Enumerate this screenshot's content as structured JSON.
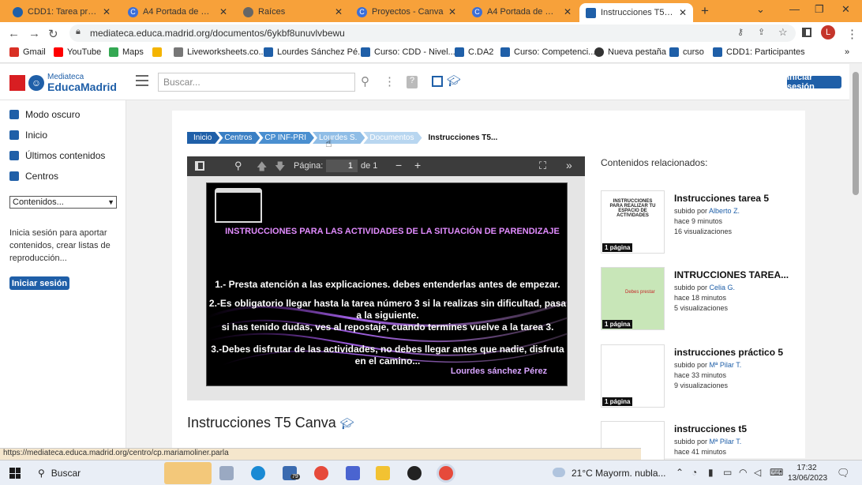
{
  "browser": {
    "tabs": [
      {
        "label": "CDD1: Tarea práctica",
        "color": "#1f5fa8"
      },
      {
        "label": "A4 Portada de Propue",
        "color": "#3b6fd8"
      },
      {
        "label": "Raíces",
        "color": "#555555"
      },
      {
        "label": "Proyectos - Canva",
        "color": "#3b6fd8"
      },
      {
        "label": "A4 Portada de Propue",
        "color": "#3b6fd8"
      },
      {
        "label": "Instrucciones T5 Canv",
        "color": "#1f5fa8"
      }
    ],
    "new_tab": "+",
    "url": "mediateca.educa.madrid.org/documentos/6ykbf8unuvlvbewu",
    "profile_initial": "L",
    "bookmarks": [
      {
        "label": "Gmail",
        "color": "#d93025"
      },
      {
        "label": "YouTube",
        "color": "#ff0000"
      },
      {
        "label": "Maps",
        "color": "#34a853"
      },
      {
        "label": "",
        "color": "#f4b400"
      },
      {
        "label": "Liveworksheets.co...",
        "color": "#777777"
      },
      {
        "label": "Lourdes Sánchez Pé...",
        "color": "#1f5fa8"
      },
      {
        "label": "Curso: CDD - Nivel...",
        "color": "#1f5fa8"
      },
      {
        "label": "C.DA2",
        "color": "#1f5fa8"
      },
      {
        "label": "Curso: Competenci...",
        "color": "#1f5fa8"
      },
      {
        "label": "Nueva pestaña",
        "color": "#333333"
      },
      {
        "label": "curso",
        "color": "#1f5fa8"
      },
      {
        "label": "CDD1: Participantes",
        "color": "#1f5fa8"
      }
    ]
  },
  "header": {
    "logo_small": "Mediateca",
    "logo_big": "EducaMadrid",
    "search_placeholder": "Buscar...",
    "login_label": "Iniciar sesión"
  },
  "sidebar": {
    "items": [
      "Modo oscuro",
      "Inicio",
      "Últimos contenidos",
      "Centros"
    ],
    "select_value": "Contenidos...",
    "info": "Inicia sesión para aportar contenidos, crear listas de reproducción...",
    "login_label": "Iniciar sesión"
  },
  "breadcrumb": {
    "items": [
      {
        "label": "Inicio",
        "color": "#1f5fa8"
      },
      {
        "label": "Centros",
        "color": "#3a7fc4"
      },
      {
        "label": "CP INF-PRI",
        "color": "#4a8fd0"
      },
      {
        "label": "Lourdes S.",
        "color": "#8fbde6"
      },
      {
        "label": "Documentos",
        "color": "#b8d6f0"
      }
    ],
    "current": "Instrucciones T5..."
  },
  "pdf": {
    "page_label": "Página:",
    "page_value": "1",
    "page_total": "de 1",
    "slide_title": "INSTRUCCIONES PARA LAS ACTIVIDADES DE LA SITUACIÓN DE PARENDIZAJE",
    "slide_lines": [
      "1.- Presta  atención a las explicaciones. debes entenderlas antes de empezar.",
      "2.-Es obligatorio llegar hasta la tarea número 3 si la realizas sin dificultad, pasa a la siguiente.",
      "si has tenido dudas, ves al repostaje, cuando termines vuelve a la tarea 3.",
      "3.-Debes disfrutar de las actividades, no debes llegar antes que nadie, disfruta en el camino...",
      "Lourdes  sánchez Pérez"
    ]
  },
  "document": {
    "title": "Instrucciones T5 Canva"
  },
  "related": {
    "heading": "Contenidos relacionados:",
    "items": [
      {
        "title": "Instrucciones tarea 5",
        "uploader_prefix": "subido por",
        "user": "Alberto Z.",
        "time": "hace 9 minutos",
        "views": "16 visualizaciones",
        "pages": "1 página",
        "thumb_text": "INSTRUCCIONES PARA REALIZAR TU ESPACIO DE ACTIVIDADES"
      },
      {
        "title": "INTRUCCIONES TAREA...",
        "uploader_prefix": "subido por",
        "user": "Celia G.",
        "time": "hace 18 minutos",
        "views": "5 visualizaciones",
        "pages": "1 página",
        "thumb_text": "Debes prestar"
      },
      {
        "title": "instrucciones práctico 5",
        "uploader_prefix": "subido por",
        "user": "Mª Pilar T.",
        "time": "hace 33 minutos",
        "views": "9 visualizaciones",
        "pages": "1 página",
        "thumb_text": ""
      },
      {
        "title": "instrucciones t5",
        "uploader_prefix": "subido por",
        "user": "Mª Pilar T.",
        "time": "hace 41 minutos",
        "views": "",
        "pages": "",
        "thumb_text": ""
      }
    ]
  },
  "status_bar": "https://mediateca.educa.madrid.org/centro/cp.mariamoliner.parla",
  "taskbar": {
    "search_label": "Buscar",
    "mail_badge": "79",
    "weather": "21°C  Mayorm. nubla...",
    "time": "17:32",
    "date": "13/06/2023"
  }
}
